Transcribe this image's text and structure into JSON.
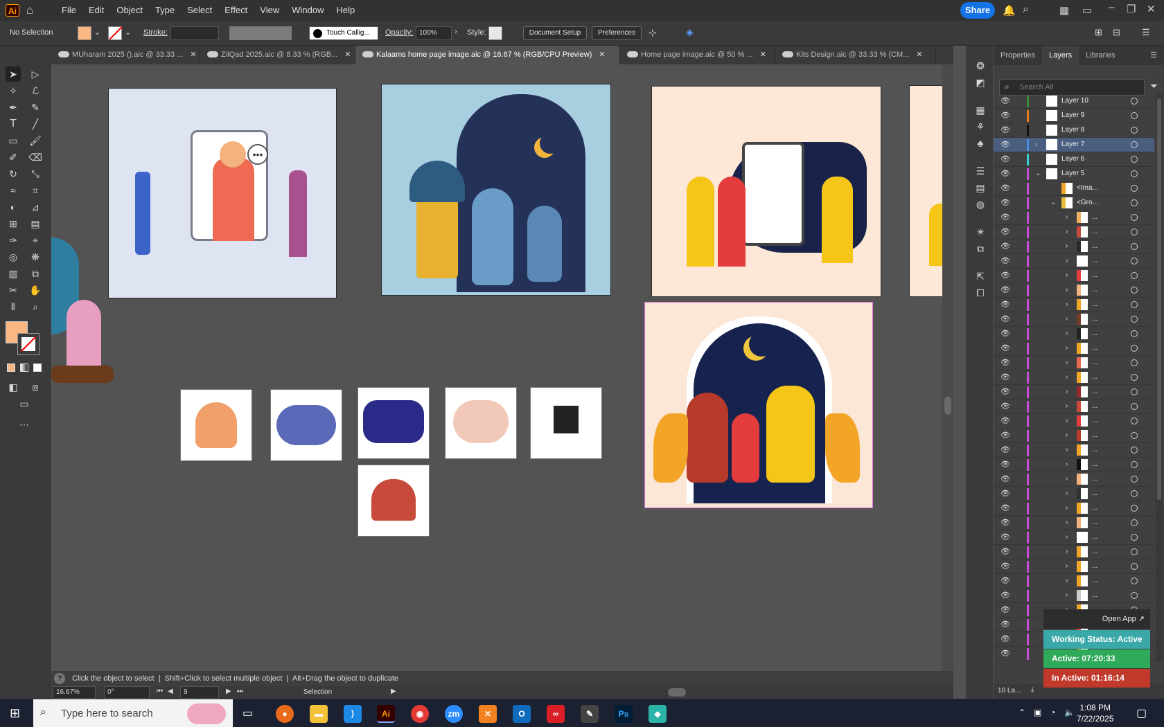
{
  "app": {
    "logo": "Ai",
    "menus": [
      "File",
      "Edit",
      "Object",
      "Type",
      "Select",
      "Effect",
      "View",
      "Window",
      "Help"
    ],
    "share": "Share"
  },
  "control": {
    "selection": "No Selection",
    "stroke_label": "Stroke:",
    "brush": "Touch Callig...",
    "opacity_label": "Opacity:",
    "opacity_value": "100%",
    "style_label": "Style:",
    "doc_setup": "Document Setup",
    "preferences": "Preferences"
  },
  "tabs": [
    {
      "label": "MUharam 2025 ().aic @ 33.33 ...",
      "active": false
    },
    {
      "label": "ZilQad 2025.aic @ 8.33 % (RGB...",
      "active": false
    },
    {
      "label": "Kalaams home page image.aic @ 16.67 % (RGB/CPU Preview)",
      "active": true
    },
    {
      "label": "Home page image.aic @ 50 % ...",
      "active": false
    },
    {
      "label": "Kits Design.aic @ 33.33 % (CM...",
      "active": false
    }
  ],
  "status": {
    "hint": "Click the object to select",
    "hint2": "Shift+Click to select multiple object",
    "hint3": "Alt+Drag the object to duplicate"
  },
  "bottom": {
    "zoom": "16.67%",
    "angle": "0°",
    "artboard": "9",
    "tool": "Selection"
  },
  "panel": {
    "tabs": [
      "Properties",
      "Layers",
      "Libraries"
    ],
    "search_placeholder": "Search All",
    "layer_count": "10 La..."
  },
  "layers": [
    {
      "name": "Layer 10",
      "color": "#3a8a3a",
      "indent": 0,
      "arrow": "",
      "sel": false
    },
    {
      "name": "Layer 9",
      "color": "#e87a1a",
      "indent": 0,
      "arrow": "",
      "sel": false
    },
    {
      "name": "Layer 8",
      "color": "#111111",
      "indent": 0,
      "arrow": "",
      "sel": false
    },
    {
      "name": "Layer 7",
      "color": "#4c8ee0",
      "indent": 0,
      "arrow": "›",
      "sel": true
    },
    {
      "name": "Layer 6",
      "color": "#3ad0d0",
      "indent": 0,
      "arrow": "",
      "sel": false
    },
    {
      "name": "Layer 5",
      "color": "#c84cd8",
      "indent": 0,
      "arrow": "⌄",
      "sel": false
    },
    {
      "name": "<Ima...",
      "color": "#c84cd8",
      "indent": 1,
      "arrow": "",
      "sel": false
    },
    {
      "name": "<Gro...",
      "color": "#c84cd8",
      "indent": 1,
      "arrow": "⌄",
      "sel": false
    },
    {
      "name": "...",
      "color": "#c84cd8",
      "indent": 2,
      "arrow": "›",
      "sel": false
    },
    {
      "name": "...",
      "color": "#c84cd8",
      "indent": 2,
      "arrow": "›",
      "sel": false
    },
    {
      "name": "...",
      "color": "#c84cd8",
      "indent": 2,
      "arrow": "›",
      "sel": false
    },
    {
      "name": "...",
      "color": "#c84cd8",
      "indent": 2,
      "arrow": "›",
      "sel": false
    },
    {
      "name": "...",
      "color": "#c84cd8",
      "indent": 2,
      "arrow": "›",
      "sel": false
    },
    {
      "name": "...",
      "color": "#c84cd8",
      "indent": 2,
      "arrow": "›",
      "sel": false
    },
    {
      "name": "...",
      "color": "#c84cd8",
      "indent": 2,
      "arrow": "›",
      "sel": false
    },
    {
      "name": "...",
      "color": "#c84cd8",
      "indent": 2,
      "arrow": "›",
      "sel": false
    },
    {
      "name": "...",
      "color": "#c84cd8",
      "indent": 2,
      "arrow": "›",
      "sel": false
    },
    {
      "name": "...",
      "color": "#c84cd8",
      "indent": 2,
      "arrow": "›",
      "sel": false
    },
    {
      "name": "...",
      "color": "#c84cd8",
      "indent": 2,
      "arrow": "›",
      "sel": false
    },
    {
      "name": "...",
      "color": "#c84cd8",
      "indent": 2,
      "arrow": "›",
      "sel": false
    },
    {
      "name": "...",
      "color": "#c84cd8",
      "indent": 2,
      "arrow": "›",
      "sel": false
    },
    {
      "name": "...",
      "color": "#c84cd8",
      "indent": 2,
      "arrow": "›",
      "sel": false
    },
    {
      "name": "...",
      "color": "#c84cd8",
      "indent": 2,
      "arrow": "›",
      "sel": false
    },
    {
      "name": "...",
      "color": "#c84cd8",
      "indent": 2,
      "arrow": "›",
      "sel": false
    },
    {
      "name": "...",
      "color": "#c84cd8",
      "indent": 2,
      "arrow": "›",
      "sel": false
    },
    {
      "name": "...",
      "color": "#c84cd8",
      "indent": 2,
      "arrow": "›",
      "sel": false
    },
    {
      "name": "...",
      "color": "#c84cd8",
      "indent": 2,
      "arrow": "›",
      "sel": false
    },
    {
      "name": "...",
      "color": "#c84cd8",
      "indent": 2,
      "arrow": "›",
      "sel": false
    },
    {
      "name": "...",
      "color": "#c84cd8",
      "indent": 2,
      "arrow": "›",
      "sel": false
    },
    {
      "name": "...",
      "color": "#c84cd8",
      "indent": 2,
      "arrow": "›",
      "sel": false
    },
    {
      "name": "...",
      "color": "#c84cd8",
      "indent": 2,
      "arrow": "›",
      "sel": false
    },
    {
      "name": "...",
      "color": "#c84cd8",
      "indent": 2,
      "arrow": "›",
      "sel": false
    },
    {
      "name": "...",
      "color": "#c84cd8",
      "indent": 2,
      "arrow": "›",
      "sel": false
    },
    {
      "name": "...",
      "color": "#c84cd8",
      "indent": 2,
      "arrow": "›",
      "sel": false
    },
    {
      "name": "...",
      "color": "#c84cd8",
      "indent": 2,
      "arrow": "›",
      "sel": false
    },
    {
      "name": "...",
      "color": "#c84cd8",
      "indent": 2,
      "arrow": "›",
      "sel": false
    },
    {
      "name": "...",
      "color": "#c84cd8",
      "indent": 2,
      "arrow": "›",
      "sel": false
    },
    {
      "name": "...",
      "color": "#c84cd8",
      "indent": 2,
      "arrow": "›",
      "sel": false
    },
    {
      "name": "...",
      "color": "#c84cd8",
      "indent": 2,
      "arrow": "›",
      "sel": false
    }
  ],
  "widget": {
    "open_app": "Open App ↗",
    "working": "Working Status: Active",
    "active_label": "Active:",
    "active_time": "07:20:33",
    "inactive_label": "In Active:",
    "inactive_time": "01:16:14"
  },
  "taskbar": {
    "search": "Type here to search",
    "time": "1:08 PM",
    "date": "7/22/2025"
  },
  "colors": {
    "accent": "#1473e6",
    "fill_swatch": "#f9b784",
    "selected_layer": "#4a5f80",
    "active_green": "#2eaa5a",
    "inactive_red": "#c0392b",
    "working_teal": "#3aa8a8"
  }
}
